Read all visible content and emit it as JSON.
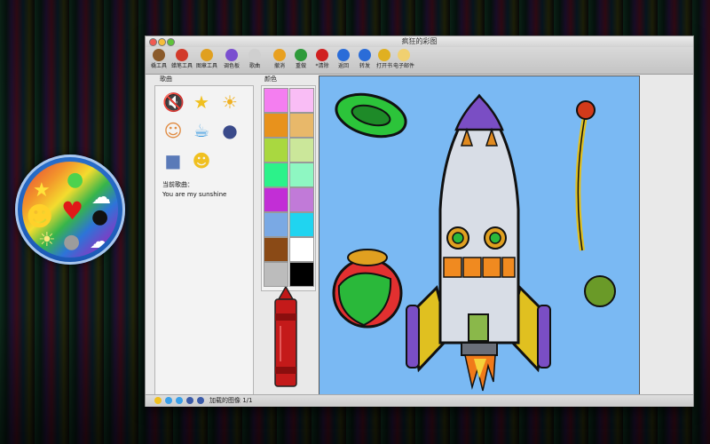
{
  "window": {
    "title": "疯狂的彩图"
  },
  "toolbar": [
    {
      "name": "brush-tool",
      "label": "橇工具",
      "icon": "brush-icon",
      "color": "#8a5a2a"
    },
    {
      "name": "crayon-tool",
      "label": "蜡笔工具",
      "icon": "crayons-icon",
      "color": "#d23a2a"
    },
    {
      "name": "stamp-tool",
      "label": "图章工具",
      "icon": "stamp-icon",
      "color": "#e0a020"
    },
    {
      "name": "palette",
      "label": "调色板",
      "icon": "palette-icon",
      "color": "#7a4fd0"
    },
    {
      "name": "music",
      "label": "歌曲",
      "icon": "music-icon",
      "color": "#cfcfcf"
    },
    {
      "name": "undo",
      "label": "撤消",
      "icon": "undo-icon",
      "color": "#e8a020"
    },
    {
      "name": "redo",
      "label": "重做",
      "icon": "redo-icon",
      "color": "#2e9a3a"
    },
    {
      "name": "clear",
      "label": "*清除",
      "icon": "clear-icon",
      "color": "#d02020"
    },
    {
      "name": "back",
      "label": "返回",
      "icon": "back-arrow-icon",
      "color": "#2a6cd8"
    },
    {
      "name": "forward",
      "label": "转发",
      "icon": "forward-arrow-icon",
      "color": "#2a6cd8"
    },
    {
      "name": "open-book",
      "label": "打开书",
      "icon": "book-icon",
      "color": "#e0b020"
    },
    {
      "name": "email",
      "label": "电子邮件",
      "icon": "mail-icon",
      "color": "#f0d070"
    }
  ],
  "songs": {
    "title": "歌曲",
    "icons": [
      "mute-speaker-icon",
      "star-icon",
      "sun-cloud-icon",
      "person-icon",
      "teapot-icon",
      "mouse-icon",
      "cow-icon",
      "smiley-icon"
    ],
    "current_label": "当前歌曲：",
    "current_song": "You are my sunshine"
  },
  "colors": {
    "title": "颜色",
    "swatches": [
      "#f47ef0",
      "#f9bdf5",
      "#e8921c",
      "#e8b86a",
      "#a9d840",
      "#cbe79a",
      "#2cf28a",
      "#8ef7c2",
      "#c22ed6",
      "#c17ad8",
      "#7aa9e4",
      "#20d4f0",
      "#8a4a16",
      "#ffffff",
      "#bcbcbc",
      "#000000"
    ]
  },
  "status": {
    "text": "加载的图像 1/1"
  },
  "canvas": {
    "background": "#7ab9f3"
  }
}
